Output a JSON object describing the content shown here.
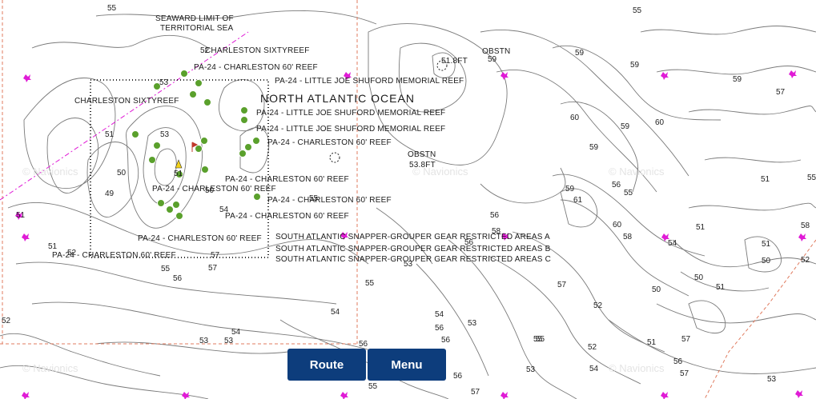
{
  "labels": {
    "seaward_limit_1": "SEAWARD LIMIT OF",
    "seaward_limit_2": "TERRITORIAL SEA",
    "ocean": "NORTH ATLANTIC OCEAN",
    "charleston_sixtyreef_1": "CHARLESTON SIXTYREEF",
    "charleston_sixtyreef_2": "CHARLESTON SIXTYREEF",
    "pa24_charleston_1": "PA-24 - CHARLESTON 60' REEF",
    "pa24_little_joe_1": "PA-24 - LITTLE JOE SHUFORD MEMORIAL REEF",
    "pa24_little_joe_2": "PA-24 - LITTLE JOE SHUFORD MEMORIAL REEF",
    "pa24_little_joe_3": "PA-24 - LITTLE JOE SHUFORD MEMORIAL REEF",
    "pa24_charleston_2": "PA-24 - CHARLESTON 60' REEF",
    "pa24_charleston_3": "PA-24 - CHARLESTON 60' REEF",
    "pa24_charleston_4": "PA-24 - CHARLESTON 60' REEF",
    "pa24_charleston_5": "PA-24 - CHARLESTON 60' REEF",
    "pa24_charleston_6": "PA-24 - CHARLESTON 60' REEF",
    "pa24_charleston_7": "PA-24 - CHARLESTON 60' REEF",
    "pa24_charleston_8": "PA-24 - CHARLESTON 60' REEF",
    "snapper_a": "SOUTH ATLANTIC SNAPPER-GROUPER GEAR RESTRICTED AREAS A",
    "snapper_b": "SOUTH ATLANTIC SNAPPER-GROUPER GEAR RESTRICTED AREAS B",
    "snapper_c": "SOUTH ATLANTIC SNAPPER-GROUPER GEAR RESTRICTED AREAS C",
    "obstn_1": "OBSTN",
    "obstn_2": "OBSTN",
    "obstn_2_depth": "53.8FT",
    "obstn_1_depth": "51.8FT"
  },
  "watermark": "© Navionics",
  "depths": [
    "55",
    "55",
    "52",
    "53",
    "53",
    "51",
    "50",
    "49",
    "51",
    "51",
    "52",
    "51",
    "50",
    "54",
    "57",
    "57",
    "55",
    "56",
    "54",
    "54",
    "53",
    "53",
    "52",
    "56",
    "56",
    "55",
    "55",
    "53",
    "59",
    "59",
    "59",
    "59",
    "60",
    "60",
    "59",
    "59",
    "59",
    "57",
    "56",
    "55",
    "51",
    "55",
    "61",
    "60",
    "56",
    "58",
    "58",
    "58",
    "57",
    "56",
    "55",
    "54",
    "51",
    "50",
    "50",
    "51",
    "52",
    "52",
    "50",
    "51",
    "52",
    "54",
    "53",
    "54",
    "53",
    "56",
    "57",
    "57",
    "56",
    "56",
    "55",
    "55",
    "57",
    "53",
    "51"
  ],
  "buttons": {
    "route": "Route",
    "menu": "Menu"
  },
  "colors": {
    "contour": "#6e6e6e",
    "boundary": "#e07b5f",
    "magenta": "#e01bd6",
    "reef_green": "#5aa02c",
    "button": "#0d3d7c"
  }
}
